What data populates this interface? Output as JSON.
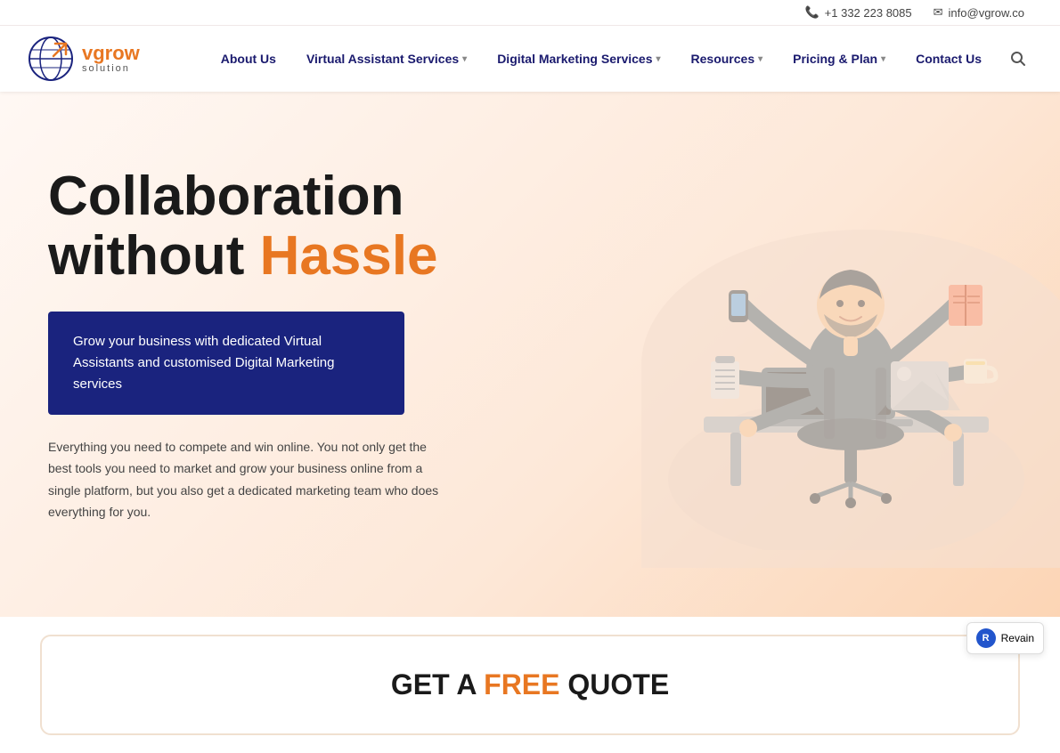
{
  "topbar": {
    "phone": "+1 332 223 8085",
    "email": "info@vgrow.co"
  },
  "logo": {
    "brand": "vgrow",
    "brand_highlight": "solution",
    "tagline": "solution"
  },
  "nav": {
    "items": [
      {
        "label": "About Us",
        "has_dropdown": false
      },
      {
        "label": "Virtual Assistant Services",
        "has_dropdown": true
      },
      {
        "label": "Digital Marketing Services",
        "has_dropdown": true
      },
      {
        "label": "Resources",
        "has_dropdown": true
      },
      {
        "label": "Pricing & Plan",
        "has_dropdown": true
      },
      {
        "label": "Contact Us",
        "has_dropdown": false
      }
    ]
  },
  "hero": {
    "headline_line1": "Collaboration",
    "headline_line2_plain": "without",
    "headline_line2_orange": "Hassle",
    "tagline": "Grow your business with dedicated Virtual Assistants and customised Digital Marketing services",
    "body": "Everything you need to compete and win online. You not only get the best tools you need to market and grow your business online from a single platform, but you also get a dedicated marketing team who does everything for you."
  },
  "quote_section": {
    "prefix": "GET A",
    "highlight": "FREE",
    "suffix": "QUOTE"
  },
  "revain": {
    "label": "Revain"
  }
}
